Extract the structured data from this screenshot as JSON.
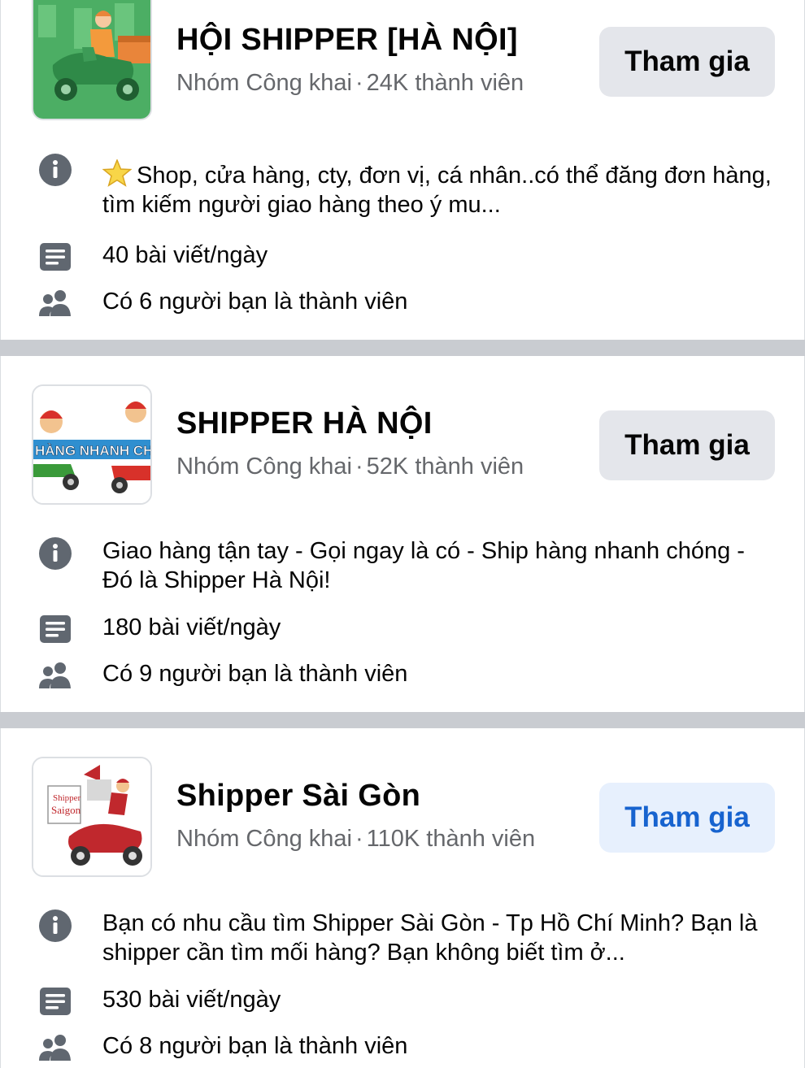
{
  "groups": [
    {
      "name": "HỘI SHIPPER [HÀ NỘI]",
      "privacy": "Nhóm Công khai",
      "members": "24K thành viên",
      "join_label": "Tham gia",
      "description": "Shop, cửa hàng, cty, đơn vị, cá nhân..có thể đăng đơn hàng, tìm kiếm người giao hàng theo ý mu...",
      "posts": "40 bài viết/ngày",
      "friends": "Có 6 người bạn là thành viên",
      "thumb_bg": "#4cae64"
    },
    {
      "name": "SHIPPER HÀ NỘI",
      "privacy": "Nhóm Công khai",
      "members": "52K thành viên",
      "join_label": "Tham gia",
      "description": "Giao hàng tận tay - Gọi ngay là có - Ship hàng nhanh chóng - Đó là Shipper Hà Nội!",
      "posts": "180 bài viết/ngày",
      "friends": "Có 9 người bạn là thành viên",
      "thumb_text": "HÀNG NHANH CH"
    },
    {
      "name": "Shipper Sài Gòn",
      "privacy": "Nhóm Công khai",
      "members": "110K thành viên",
      "join_label": "Tham gia",
      "description": "Bạn có nhu cầu tìm Shipper Sài Gòn - Tp Hồ Chí Minh? Bạn là shipper cần tìm mối hàng? Bạn không biết tìm ở...",
      "posts": "530 bài viết/ngày",
      "friends": "Có 8 người bạn là thành viên",
      "thumb_text_1": "Shipper",
      "thumb_text_2": "Saigon"
    }
  ],
  "meta_separator": "·",
  "colors": {
    "text_primary": "#050505",
    "text_secondary": "#65676b",
    "button_gray": "#e4e6eb",
    "button_blue_bg": "#e7f0fd",
    "button_blue_text": "#1763cf",
    "separator": "#c9ccd1",
    "icon": "#606770"
  },
  "icons": [
    "info-icon",
    "posts-icon",
    "friends-icon",
    "star-icon"
  ]
}
